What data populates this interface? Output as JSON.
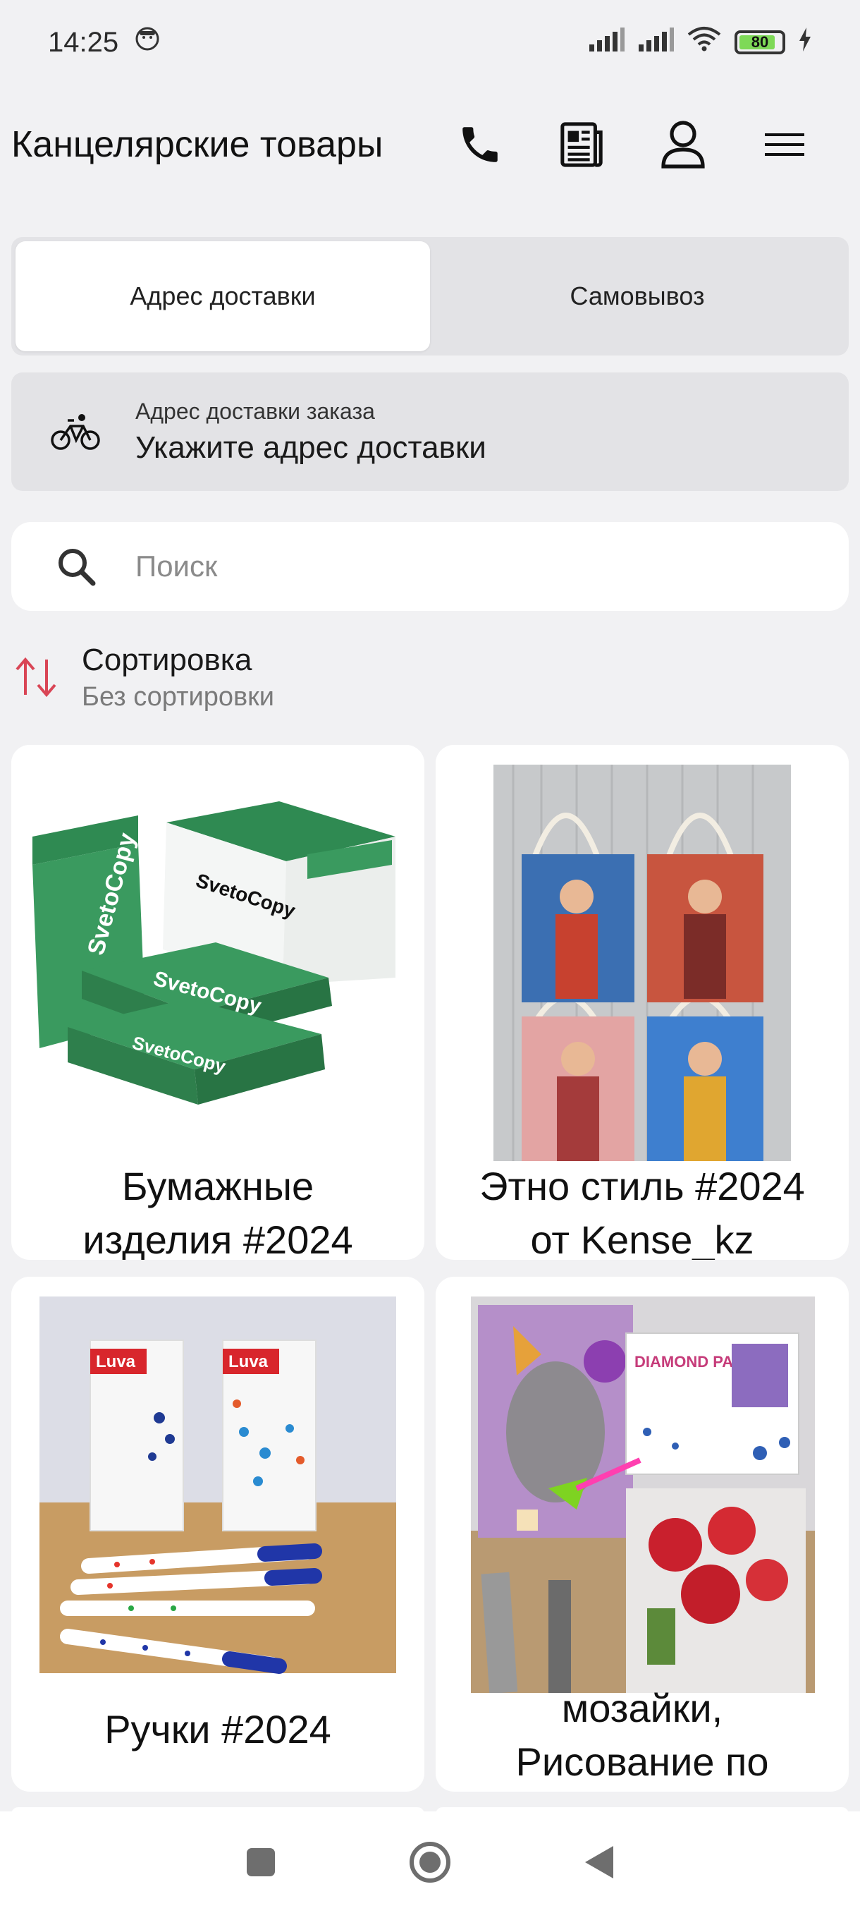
{
  "status_bar": {
    "time": "14:25",
    "battery": "80"
  },
  "header": {
    "title": "Канцелярские товары",
    "icons": [
      "phone-icon",
      "news-icon",
      "user-icon",
      "menu-icon"
    ]
  },
  "delivery_tabs": [
    {
      "label": "Адрес доставки",
      "active": true
    },
    {
      "label": "Самовывоз",
      "active": false
    }
  ],
  "address": {
    "caption": "Адрес доставки заказа",
    "value": "Укажите адрес доставки"
  },
  "search": {
    "placeholder": "Поиск"
  },
  "sort": {
    "title": "Сортировка",
    "value": "Без сортировки"
  },
  "categories": [
    {
      "line1": "Бумажные",
      "line2": "изделия #2024"
    },
    {
      "line1": "Этно стиль #2024",
      "line2": "от Kense_kz"
    },
    {
      "line1": "Ручки #2024",
      "line2": ""
    },
    {
      "line1": "мозайки,",
      "line2": "Рисование по"
    }
  ],
  "product_image_text": {
    "paper_brand": "SvetoCopy",
    "pen_brand": "Luva",
    "paint_brand": "DIAMOND PAINTING"
  },
  "colors": {
    "accent": "#d94555",
    "background": "#f1f1f3",
    "tab_bg": "#e3e3e6"
  }
}
